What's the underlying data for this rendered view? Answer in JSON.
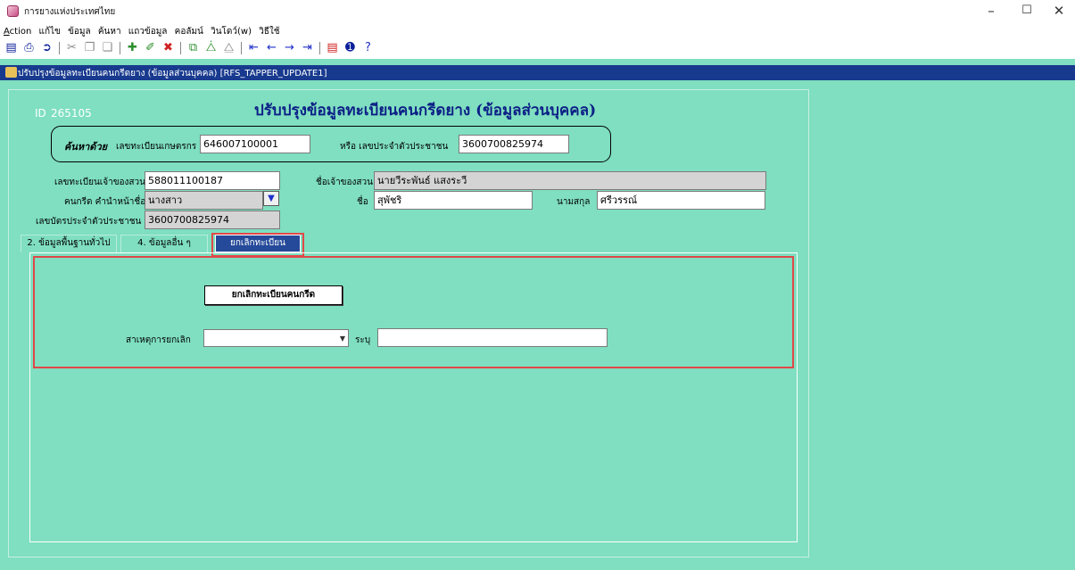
{
  "window": {
    "title": "การยางแห่งประเทศไทย",
    "minimize_glyph": "–",
    "maximize_glyph": "☐",
    "close_glyph": "✕"
  },
  "menu": [
    "Action",
    "แก้ไข",
    "ข้อมูล",
    "ค้นหา",
    "แถวข้อมูล",
    "คอลัมน์",
    "วินโดว์(w)",
    "วิธีใช้"
  ],
  "toolbar_icons": [
    "save-icon",
    "print-icon",
    "exit-icon",
    "cut-icon",
    "copy-icon",
    "paste-icon",
    "insert-record-icon",
    "edit-record-icon",
    "delete-record-icon",
    "duplicate-icon",
    "duplicate-all-icon",
    "clear-icon",
    "first-record-icon",
    "previous-record-icon",
    "next-record-icon",
    "last-record-icon",
    "chart-icon",
    "info-icon",
    "help-icon"
  ],
  "child_window": {
    "title": "ปรับปรุงข้อมูลทะเบียนคนกรีดยาง (ข้อมูลส่วนบุคคล) [RFS_TAPPER_UPDATE1]"
  },
  "form": {
    "title": "ปรับปรุงข้อมูลทะเบียนคนกรีดยาง (ข้อมูลส่วนบุคคล)",
    "record_id_label": "ID",
    "record_id": "265105",
    "search": {
      "label": "ค้นหาด้วย",
      "farmer_reg_label": "เลขทะเบียนเกษตรกร",
      "farmer_reg_value": "646007100001",
      "or_citizen_label": "หรือ เลขประจำตัวประชาชน",
      "citizen_value": "3600700825974"
    },
    "garden_reg_label": "เลขทะเบียนเจ้าของสวน",
    "garden_reg_value": "588011100187",
    "owner_name_label": "ชื่อเจ้าของสวน",
    "owner_name_value": "นายวีระพันธ์ แสงระวี",
    "prefix_label": "คนกรีด คำนำหน้าชื่อ",
    "prefix_value": "นางสาว",
    "first_name_label": "ชื่อ",
    "first_name_value": "สุพัชริ",
    "last_name_label": "นามสกุล",
    "last_name_value": "ศรีวรรณ์",
    "citizen_id_label": "เลขบัตรประจำตัวประชาชน",
    "citizen_id_value": "3600700825974"
  },
  "tabs": [
    {
      "label": "2. ข้อมูลพื้นฐานทั่วไป",
      "active": false
    },
    {
      "label": "4. ข้อมูลอื่น ๆ",
      "active": false
    },
    {
      "label": "ยกเลิกทะเบียน",
      "active": true
    }
  ],
  "cancel_section": {
    "button_label": "ยกเลิกทะเบียนคนกรีด",
    "reason_label": "สาเหตุการยกเลิก",
    "reason_value": "",
    "specify_label": "ระบุ",
    "specify_value": ""
  },
  "colors": {
    "mdi_background": "#7fdfc0",
    "child_title_bar": "#183a8e",
    "form_title": "#0c1f86",
    "active_tab": "#264a9a",
    "highlight_box": "#e04848"
  }
}
